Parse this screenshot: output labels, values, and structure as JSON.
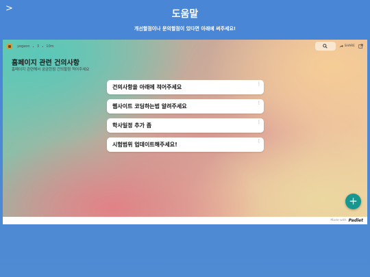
{
  "header": {
    "back_glyph": ">",
    "title": "도움말",
    "subtitle": "개선할점이나 문의할점이 있다면 아래에 써주세요!"
  },
  "board": {
    "owner": "yegeon",
    "separator": "•",
    "likes": "3",
    "time": "10m",
    "search_icon": "magnifier-icon",
    "share_label": "SHARE",
    "title": "홈페이지 관련 건의사항",
    "description": "홈페이지 관련해서 궁금한점 건의할점 적어주세요",
    "posts": [
      {
        "text": "건의사항을 아래에 적어주세요"
      },
      {
        "text": "웹사이트 코딩하는법 알려주세요"
      },
      {
        "text": "학사일정 추가 좀"
      },
      {
        "text": "시험범위 업데이트해주세요!"
      }
    ],
    "post_menu_glyph": "⋮",
    "fab_glyph": "+"
  },
  "footer": {
    "made_with": "Made with",
    "brand": "Padlet"
  },
  "colors": {
    "page_bg": "#4a86d6",
    "fab": "#17978f"
  }
}
